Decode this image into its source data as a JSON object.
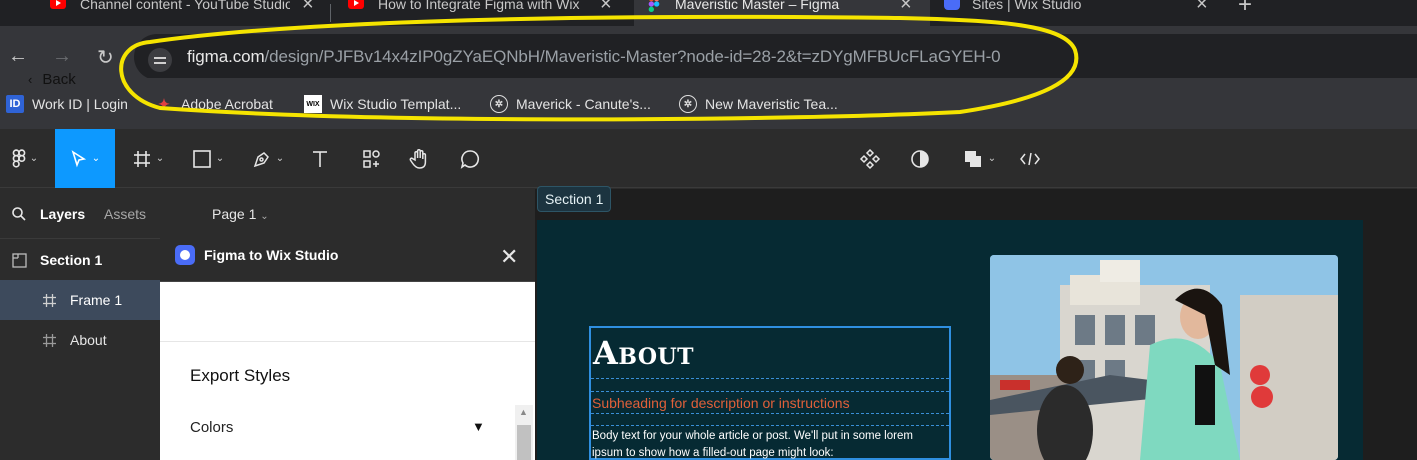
{
  "browser": {
    "tabs": [
      {
        "title": "Channel content - YouTube Studio",
        "icon": "youtube-icon",
        "active": false
      },
      {
        "title": "How to Integrate Figma with Wix",
        "icon": "youtube-icon",
        "active": false
      },
      {
        "title": "Maveristic Master – Figma",
        "icon": "figma-icon",
        "active": true
      },
      {
        "title": "Sites | Wix Studio",
        "icon": "wix-studio-icon",
        "active": false
      }
    ],
    "url_host": "figma.com",
    "url_path": "/design/PJFBv14x4zIP0gZYaEQNbH/Maveristic-Master?node-id=28-2&t=zDYgMFBUcFLaGYEH-0",
    "bookmarks": [
      {
        "label": "Work ID | Login",
        "icon": "id-icon"
      },
      {
        "label": "Adobe Acrobat",
        "icon": "acrobat-icon"
      },
      {
        "label": "Wix Studio Templat...",
        "icon": "wix-icon"
      },
      {
        "label": "Maverick - Canute's...",
        "icon": "openai-icon"
      },
      {
        "label": "New Maveristic Tea...",
        "icon": "openai-icon"
      }
    ],
    "annotation_color": "#f5e400"
  },
  "figma": {
    "left_panel": {
      "tab_layers": "Layers",
      "tab_assets": "Assets",
      "page_selector": "Page 1",
      "layers": [
        {
          "name": "Section 1",
          "icon": "section-icon",
          "selected": false
        },
        {
          "name": "Frame 1",
          "icon": "frame-icon",
          "selected": true
        },
        {
          "name": "About",
          "icon": "frame-icon",
          "selected": false
        }
      ]
    },
    "accent": "#0d99ff",
    "plugin": {
      "title": "Figma to Wix Studio",
      "back_label": "Back",
      "section_title": "Export Styles",
      "colors_label": "Colors"
    },
    "canvas": {
      "section_label": "Section 1",
      "frame_bg": "#062a33",
      "about_title": "About",
      "subheading": "Subheading for description or instructions",
      "body": "Body text for your whole article or post. We'll put in some lorem ipsum to show how a filled-out page might look:",
      "subheading_color": "#e0603a"
    }
  }
}
